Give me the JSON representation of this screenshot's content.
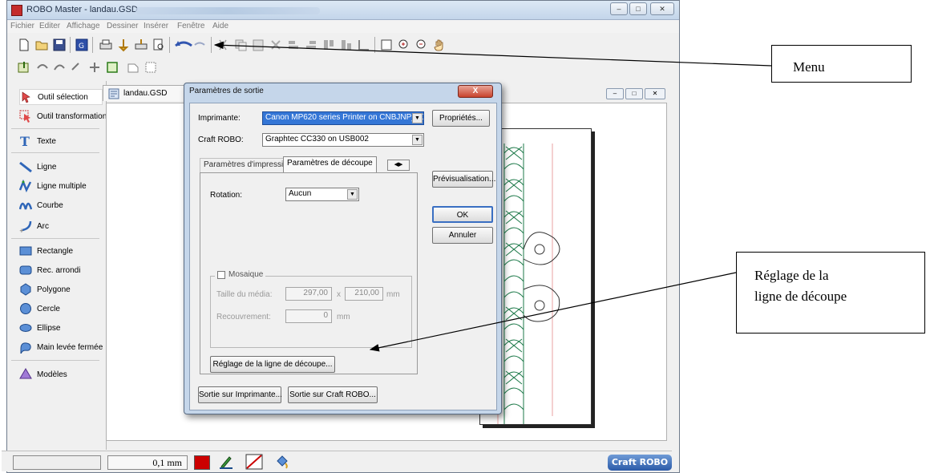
{
  "window": {
    "title": "ROBO Master - landau.GSD",
    "menu": [
      "Fichier",
      "Editer",
      "Affichage",
      "Dessiner",
      "Insérer",
      "Fenêtre",
      "Aide"
    ]
  },
  "tools": [
    {
      "label": "Outil sélection",
      "icon": "select-arrow-icon"
    },
    {
      "label": "Outil transformation",
      "icon": "transform-icon"
    },
    {
      "label": "Texte",
      "icon": "text-icon"
    },
    {
      "label": "Ligne",
      "icon": "line-icon"
    },
    {
      "label": "Ligne multiple",
      "icon": "polyline-icon"
    },
    {
      "label": "Courbe",
      "icon": "curve-icon"
    },
    {
      "label": "Arc",
      "icon": "arc-icon"
    },
    {
      "label": "Rectangle",
      "icon": "rectangle-icon"
    },
    {
      "label": "Rec. arrondi",
      "icon": "rounded-rectangle-icon"
    },
    {
      "label": "Polygone",
      "icon": "polygon-icon"
    },
    {
      "label": "Cercle",
      "icon": "circle-icon"
    },
    {
      "label": "Ellipse",
      "icon": "ellipse-icon"
    },
    {
      "label": "Main levée fermée",
      "icon": "freehand-icon"
    },
    {
      "label": "Modèles",
      "icon": "templates-icon"
    }
  ],
  "document": {
    "tab_title": "landau.GSD"
  },
  "status": {
    "line_width": "0,1 mm",
    "fill_color": "#cc0000"
  },
  "dialog": {
    "title": "Paramètres de sortie",
    "close": "X",
    "printer_label": "Imprimante:",
    "printer_value": "Canon MP620 series Printer on CNBJNP_000",
    "craft_label": "Craft ROBO:",
    "craft_value": "Graphtec CC330 on USB002",
    "properties_button": "Propriétés...",
    "preview_button": "Prévisualisation...",
    "ok_button": "OK",
    "cancel_button": "Annuler",
    "tabs": [
      "Paramètres d'impression",
      "Paramètres de découpe"
    ],
    "rotation_label": "Rotation:",
    "rotation_value": "Aucun",
    "mosaic_label": "Mosaique",
    "media_size_label": "Taille du média:",
    "media_width": "297,00",
    "times": "x",
    "media_height": "210,00",
    "unit_mm": "mm",
    "overlap_label": "Recouvrement:",
    "overlap_value": "0",
    "cutline_button": "Réglage de la ligne de découpe...",
    "print_button": "Sortie sur Imprimante...",
    "craft_button": "Sortie sur Craft ROBO..."
  },
  "annotations": {
    "menu": "Menu",
    "cutline_line1": "Réglage de la",
    "cutline_line2": "ligne de découpe"
  }
}
